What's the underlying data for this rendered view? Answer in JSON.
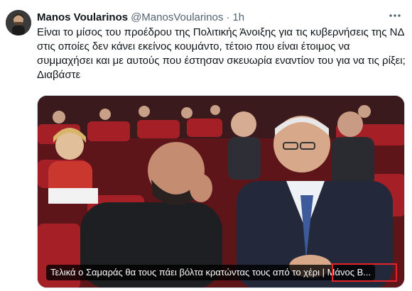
{
  "tweet": {
    "author_name": "Manos Voularinos",
    "handle": "@ManosVoularinos",
    "separator": "·",
    "time": "1h",
    "text": "Είναι το μίσος του προέδρου της Πολιτικής Άνοιξης για τις κυβερνήσεις της ΝΔ στις οποίες δεν κάνει εκείνος κουμάντο, τέτοιο που είναι έτοιμος να συμμαχήσει και με αυτούς που έστησαν σκευωρία εναντίον του για να τις ρίξει; Διαβάστε",
    "more_icon": "more-dots-icon"
  },
  "card": {
    "title": "Τελικά ο Σαμαράς θα τους πάει βόλτα κρατώντας τους από το χέρι | Μάνος Β...",
    "accent_color": "#e2232a"
  },
  "colors": {
    "text": "#0f1419",
    "secondary": "#536471",
    "border": "#cfd9de",
    "seat_red": "#9b1c22"
  }
}
